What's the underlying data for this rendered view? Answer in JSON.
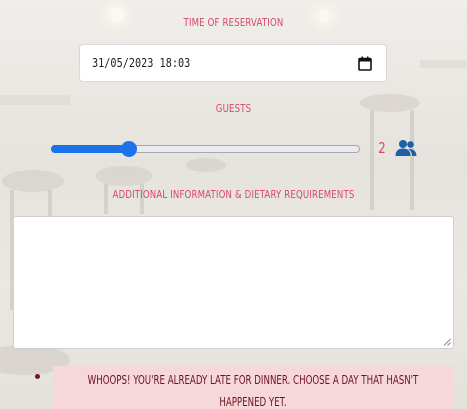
{
  "form": {
    "time_label": "Time of Reservation",
    "datetime_value": "31/05/2023 18:03",
    "guests_label": "Guests",
    "guests_value": 2,
    "guests_slider_fraction": 0.24,
    "guests_display": "2",
    "notes_label": "Additional Information & Dietary Requirements",
    "notes_value": ""
  },
  "alert": {
    "message": "Whoops! You're already late for dinner. Choose a day that hasn't happened yet."
  },
  "icons": {
    "datetime": "calendar-icon",
    "guests": "users-icon",
    "textarea": "resize-grip-icon"
  },
  "colors": {
    "label": "#d8466a",
    "accent": "#1a73e8",
    "alert_bg": "#f6d7da",
    "alert_text": "#6e1224"
  }
}
